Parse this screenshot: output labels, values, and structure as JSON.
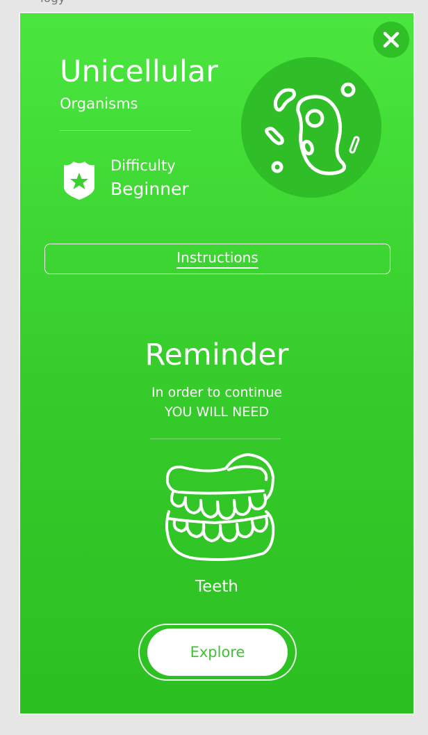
{
  "header": {
    "title": "Unicellular",
    "subtitle": "Organisms"
  },
  "difficulty": {
    "label": "Difficulty",
    "value": "Beginner",
    "icon": "shield-star-icon"
  },
  "hero_icon": "microorganism-icon",
  "close_icon": "close-icon",
  "instructions_label": "Instructions",
  "reminder": {
    "title": "Reminder",
    "line1": "In order to continue",
    "line2": "YOU WILL NEED"
  },
  "required_item": {
    "icon": "teeth-icon",
    "label": "Teeth"
  },
  "explore_label": "Explore",
  "colors": {
    "panel_top": "#4ae63f",
    "panel_bottom": "#2cbf22",
    "accent_dark": "#2fbe27",
    "button_text": "#3cc431"
  }
}
